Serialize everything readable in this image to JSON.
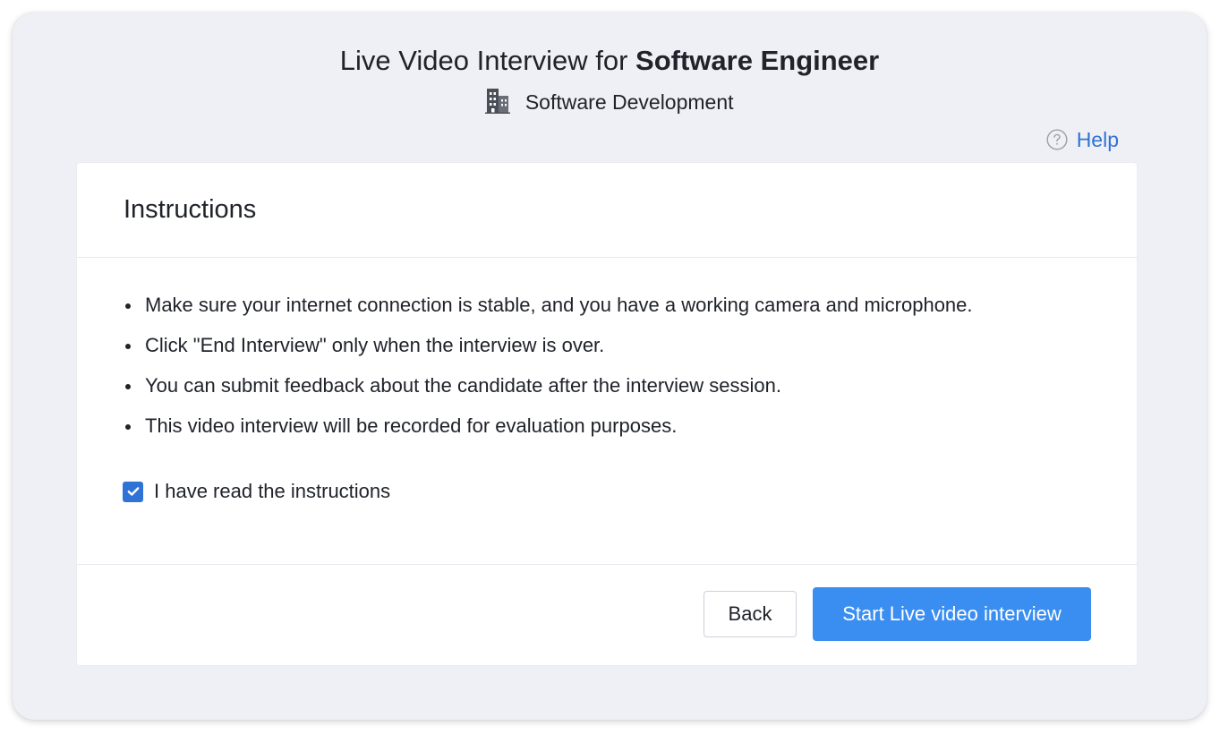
{
  "header": {
    "title_prefix": "Live Video Interview for",
    "title_role": "Software Engineer",
    "department": "Software Development",
    "help_label": "Help"
  },
  "card": {
    "title": "Instructions",
    "instructions": [
      "Make sure your internet connection is stable, and you have a working camera and microphone.",
      "Click \"End Interview\" only when the interview is over.",
      "You can submit feedback about the candidate after the interview session.",
      "This video interview will be recorded for evaluation purposes."
    ],
    "acknowledge_label": "I have read the instructions",
    "acknowledge_checked": true
  },
  "footer": {
    "back_label": "Back",
    "start_label": "Start Live video interview"
  },
  "colors": {
    "accent": "#2f73d6",
    "primary_button": "#3a8ef1",
    "background": "#eff0f5",
    "text": "#20232a"
  },
  "icons": {
    "department": "building-icon",
    "help": "question-circle-icon",
    "checkbox": "check-icon"
  }
}
